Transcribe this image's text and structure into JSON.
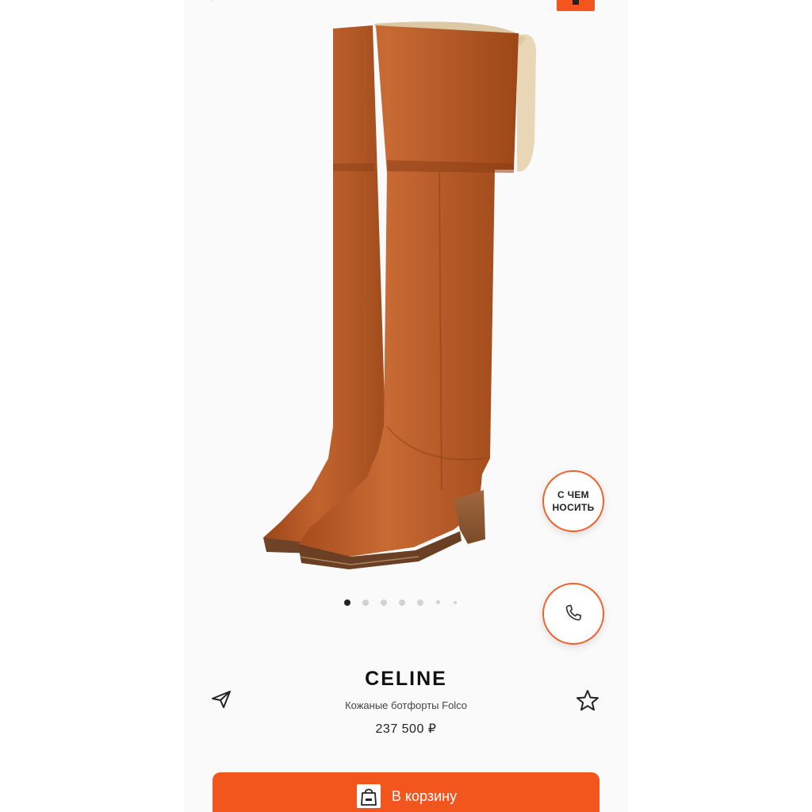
{
  "product": {
    "brand": "CELINE",
    "name": "Кожаные ботфорты Folco",
    "price": "237 500 ₽"
  },
  "actions": {
    "style_line1": "С ЧЕМ",
    "style_line2": "НОСИТЬ",
    "add_to_cart": "В корзину"
  },
  "gallery": {
    "total_images": 7,
    "current_image": 1
  },
  "icons": {
    "back": "chevron-left-icon",
    "cart": "cart-icon",
    "call": "phone-icon",
    "share": "paper-plane-icon",
    "favorite": "star-icon",
    "bag": "shopping-bag-icon"
  },
  "colors": {
    "accent": "#f2561d",
    "leather": "#b5582a",
    "text": "#111111"
  }
}
